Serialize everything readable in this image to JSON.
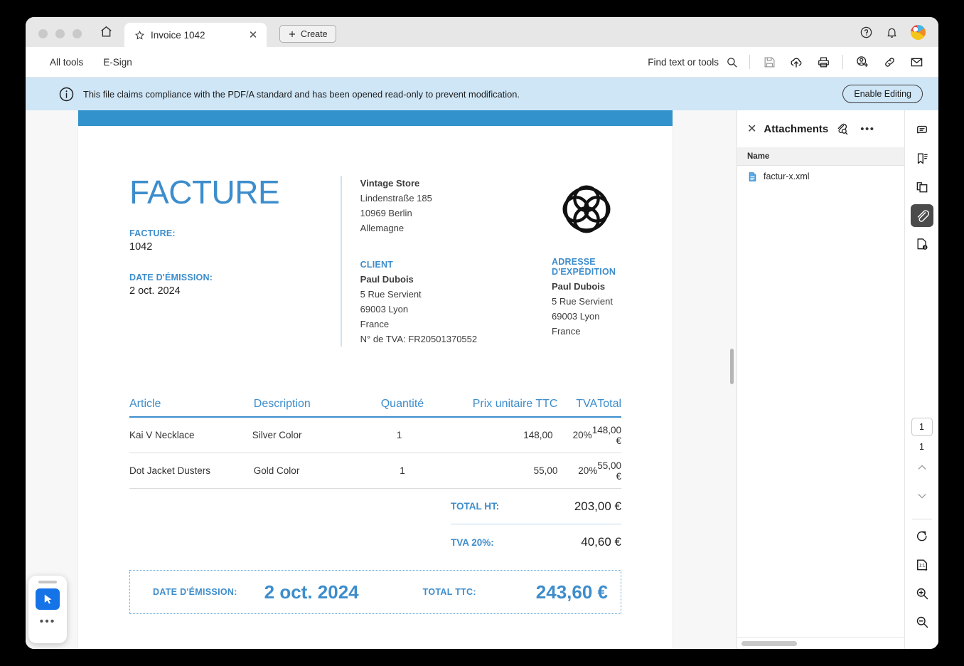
{
  "titlebar": {
    "home_tooltip": "Home",
    "tab_label": "Invoice 1042",
    "create_label": "Create"
  },
  "toolbar": {
    "all_tools": "All tools",
    "esign": "E-Sign",
    "find_placeholder": "Find text or tools"
  },
  "banner": {
    "message": "This file claims compliance with the PDF/A standard and has been opened read-only to prevent modification.",
    "button": "Enable Editing"
  },
  "panel": {
    "title": "Attachments",
    "column_name": "Name",
    "items": [
      {
        "name": "factur-x.xml"
      }
    ]
  },
  "rail": {
    "page_current": "1",
    "page_total": "1"
  },
  "document": {
    "title": "FACTURE",
    "invoice_label": "FACTURE:",
    "invoice_number": "1042",
    "date_label": "DATE D'ÉMISSION:",
    "date_value": "2 oct. 2024",
    "seller": {
      "name": "Vintage Store",
      "street": "Lindenstraße 185",
      "city": "10969 Berlin",
      "country": "Allemagne"
    },
    "client": {
      "label": "CLIENT",
      "name": "Paul Dubois",
      "street": "5 Rue Servient",
      "city": "69003 Lyon",
      "country": "France",
      "vat": "N° de TVA: FR20501370552"
    },
    "shipping": {
      "label": "ADRESSE D'EXPÉDITION",
      "name": "Paul Dubois",
      "street": "5 Rue Servient",
      "city": "69003 Lyon",
      "country": "France"
    },
    "table": {
      "headers": {
        "article": "Article",
        "description": "Description",
        "quantity": "Quantité",
        "unit_price": "Prix unitaire TTC",
        "tva": "TVA",
        "total": "Total"
      },
      "rows": [
        {
          "article": "Kai V Necklace",
          "description": "Silver Color",
          "quantity": "1",
          "unit_price": "148,00",
          "tva": "20%",
          "total": "148,00 €"
        },
        {
          "article": "Dot Jacket Dusters",
          "description": "Gold Color",
          "quantity": "1",
          "unit_price": "55,00",
          "tva": "20%",
          "total": "55,00 €"
        }
      ]
    },
    "totals": {
      "ht_label": "TOTAL HT:",
      "ht_value": "203,00 €",
      "tva_label": "TVA 20%:",
      "tva_value": "40,60 €"
    },
    "summary": {
      "date_label": "DATE D'ÉMISSION:",
      "date_value": "2 oct. 2024",
      "total_label": "TOTAL TTC:",
      "total_value": "243,60 €"
    }
  },
  "colors": {
    "accent_blue": "#3d8dcc",
    "page_band": "#3192cc",
    "banner_bg": "#cfe6f7",
    "tool_blue": "#1473e6"
  }
}
